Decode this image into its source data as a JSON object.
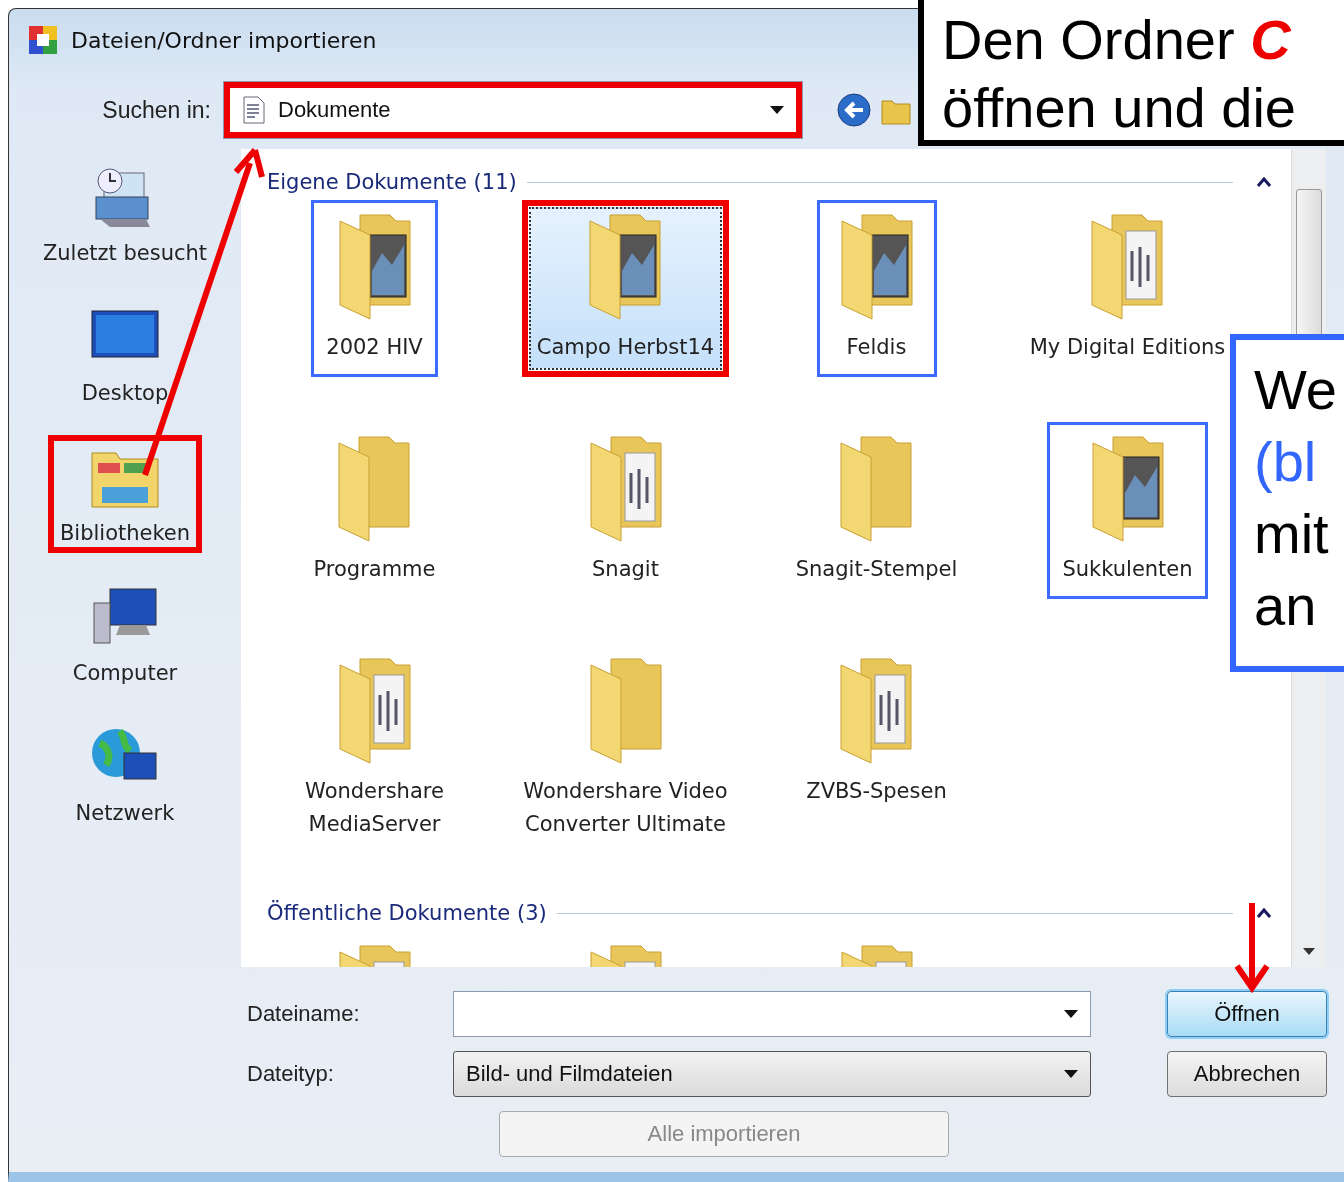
{
  "window": {
    "title": "Dateien/Ordner importieren"
  },
  "look_in": {
    "label": "Suchen in:",
    "value": "Dokumente",
    "color": "#ee0000"
  },
  "sidebar": {
    "items": [
      {
        "label": "Zuletzt besucht"
      },
      {
        "label": "Desktop"
      },
      {
        "label": "Bibliotheken",
        "color": "#ee0000"
      },
      {
        "label": "Computer"
      },
      {
        "label": "Netzwerk"
      }
    ]
  },
  "groups": [
    {
      "title": "Eigene Dokumente (11)",
      "expanded": true,
      "items": [
        {
          "label": "2002 HIV",
          "kind": "photo",
          "selected": false,
          "color": "#3c6cff"
        },
        {
          "label": "Campo Herbst14",
          "kind": "photo",
          "selected": true,
          "color": "#ee0000"
        },
        {
          "label": "Feldis",
          "kind": "photo",
          "selected": false,
          "color": "#3c6cff"
        },
        {
          "label": "My Digital Editions",
          "kind": "papers",
          "selected": false
        },
        {
          "label": "Programme",
          "kind": "plain",
          "selected": false
        },
        {
          "label": "Snagit",
          "kind": "papers",
          "selected": false
        },
        {
          "label": "Snagit-Stempel",
          "kind": "plain",
          "selected": false
        },
        {
          "label": "Sukkulenten",
          "kind": "photo",
          "selected": false,
          "color": "#3c6cff"
        },
        {
          "label": "Wondershare MediaServer",
          "kind": "papers",
          "selected": false
        },
        {
          "label": "Wondershare Video Converter Ultimate",
          "kind": "plain",
          "selected": false
        },
        {
          "label": "ZVBS-Spesen",
          "kind": "papers",
          "selected": false
        }
      ]
    },
    {
      "title": "Öffentliche Dokumente (3)",
      "expanded": true,
      "items": [
        {
          "kind": "papers",
          "selected": false
        },
        {
          "kind": "papers",
          "selected": false
        },
        {
          "kind": "papers",
          "selected": false
        }
      ]
    }
  ],
  "filename": {
    "label": "Dateiname:"
  },
  "filetype": {
    "label": "Dateityp:",
    "value": "Bild- und Filmdateien"
  },
  "buttons": [
    {
      "label": "Öffnen",
      "kind": "default"
    },
    {
      "label": "Abbrechen",
      "kind": "normal"
    }
  ],
  "import_all": {
    "label": "Alle importieren",
    "disabled": true
  },
  "annotations": [
    {
      "color": "#000000",
      "lines": [
        [
          {
            "text": "Den Ordner ",
            "kind": "plain"
          },
          {
            "text": "C",
            "kind": "emphasis"
          }
        ],
        [
          {
            "text": "öffnen und die",
            "kind": "plain"
          }
        ]
      ]
    },
    {
      "color": "#3366ff",
      "lines": [
        [
          {
            "text": "We",
            "kind": "plain"
          }
        ],
        [
          {
            "text": "(bl",
            "kind": "accent"
          }
        ],
        [
          {
            "text": "mit",
            "kind": "plain"
          }
        ],
        [
          {
            "text": "an",
            "kind": "plain"
          }
        ]
      ]
    }
  ]
}
